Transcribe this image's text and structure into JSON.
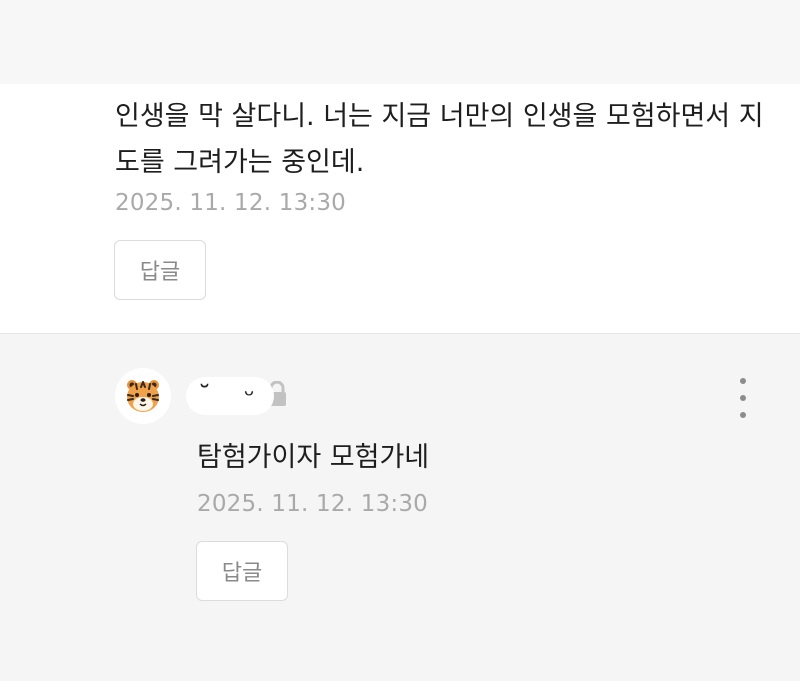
{
  "comment": {
    "text": "인생을 막 살다니. 너는 지금 너만의 인생을 모험하면서 지도를 그려가는 중인데.",
    "timestamp": "2025. 11. 12. 13:30",
    "reply_label": "답글"
  },
  "reply": {
    "author_icon": "tiger-avatar-icon",
    "lock_icon": "lock-icon",
    "more_icon": "more-vertical-icon",
    "text": "탐험가이자 모험가네",
    "timestamp": "2025. 11. 12. 13:30",
    "reply_label": "답글"
  }
}
